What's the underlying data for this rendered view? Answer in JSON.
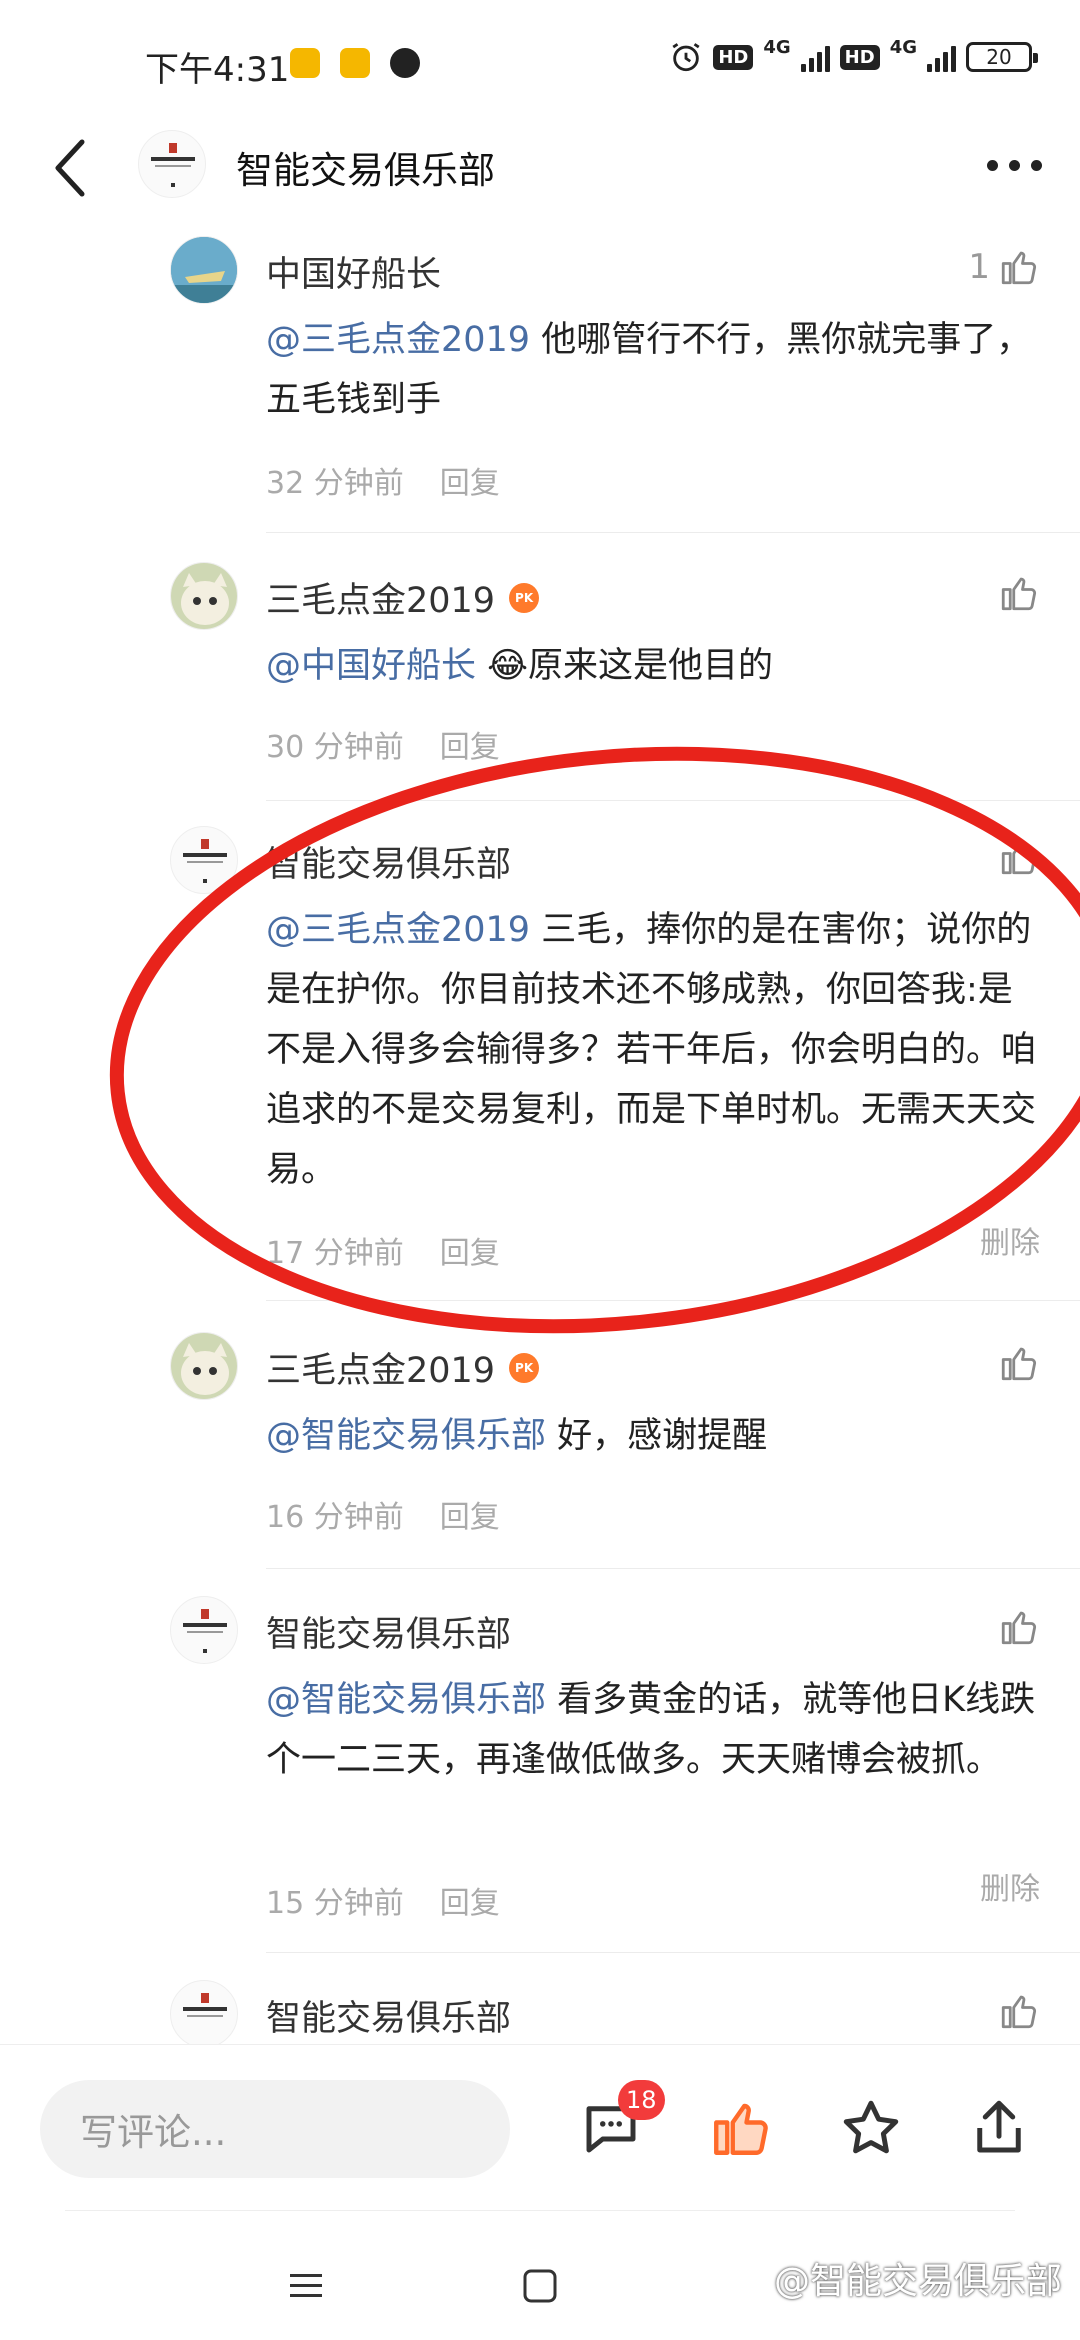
{
  "status_bar": {
    "time": "下午4:31",
    "network1": "4G",
    "network2": "4G",
    "hd": "HD",
    "battery": "20"
  },
  "header": {
    "title": "智能交易俱乐部",
    "back_icon": "chevron-left-icon",
    "more_icon": "more-horizontal-icon"
  },
  "comments": [
    {
      "author": "中国好船长",
      "like_count": "1",
      "mention": "@三毛点金2019",
      "text": " 他哪管行不行，黑你就完事了，五毛钱到手",
      "time": "32 分钟前",
      "reply": "回复"
    },
    {
      "author": "三毛点金2019",
      "badge": "PK",
      "mention": "@中国好船长",
      "text": " 😂原来这是他目的",
      "time": "30 分钟前",
      "reply": "回复"
    },
    {
      "author": "智能交易俱乐部",
      "mention": "@三毛点金2019",
      "text": " 三毛，捧你的是在害你；说你的是在护你。你目前技术还不够成熟，你回答我:是不是入得多会输得多？若干年后，你会明白的。咱追求的不是交易复利，而是下单时机。无需天天交易。",
      "time": "17 分钟前",
      "reply": "回复",
      "delete": "删除"
    },
    {
      "author": "三毛点金2019",
      "badge": "PK",
      "mention": "@智能交易俱乐部",
      "text": " 好，感谢提醒",
      "time": "16 分钟前",
      "reply": "回复"
    },
    {
      "author": "智能交易俱乐部",
      "mention": "@智能交易俱乐部",
      "text": " 看多黄金的话，就等他日K线跌个一二三天，再逢做低做多。天天赌博会被抓。",
      "time": "15 分钟前",
      "reply": "回复",
      "delete": "删除"
    },
    {
      "author": "智能交易俱乐部"
    }
  ],
  "bottom_bar": {
    "input_placeholder": "写评论...",
    "comment_count": "18"
  },
  "watermark": "@智能交易俱乐部",
  "colors": {
    "mention": "#486da4",
    "meta": "#aaaaaa",
    "annotation": "#e8231b",
    "like_active": "#ff6a2a",
    "badge": "#f23b3b"
  }
}
